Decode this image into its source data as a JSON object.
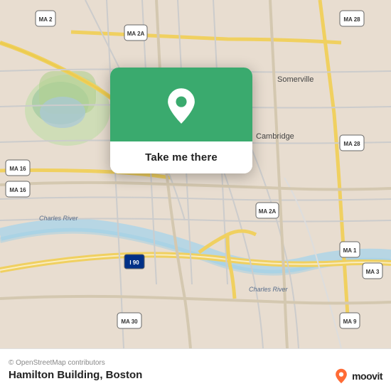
{
  "map": {
    "background_color": "#e8ddd0",
    "attribution": "© OpenStreetMap contributors"
  },
  "card": {
    "button_label": "Take me there",
    "pin_color": "#ffffff"
  },
  "bottom_bar": {
    "attribution": "© OpenStreetMap contributors",
    "location_title": "Hamilton Building, Boston"
  },
  "moovit": {
    "logo_text": "moovit"
  },
  "road_labels": [
    "MA 2",
    "MA 2A",
    "MA 28",
    "MA 16",
    "MA 1",
    "MA 3",
    "MA 9",
    "MA 30",
    "I 90",
    "Somerville",
    "Cambridge",
    "Charles River"
  ]
}
